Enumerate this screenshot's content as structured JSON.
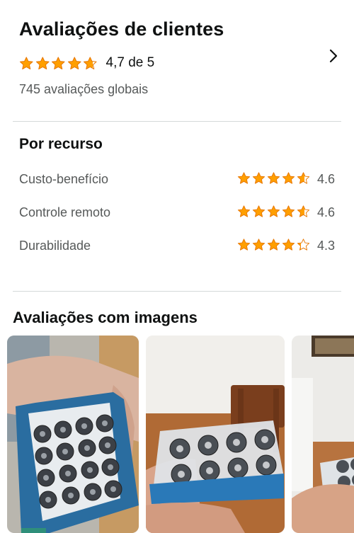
{
  "header": {
    "title": "Avaliações de clientes",
    "overall_rating": 4.7,
    "overall_text": "4,7 de 5",
    "global_count": "745 avaliações globais"
  },
  "features": {
    "title": "Por recurso",
    "items": [
      {
        "label": "Custo-benefício",
        "rating": 4.6,
        "value": "4.6"
      },
      {
        "label": "Controle remoto",
        "rating": 4.6,
        "value": "4.6"
      },
      {
        "label": "Durabilidade",
        "rating": 4.3,
        "value": "4.3"
      }
    ]
  },
  "images_section": {
    "title": "Avaliações com imagens",
    "images": [
      {
        "alt": "Caixa azul com pilhas AA"
      },
      {
        "alt": "Pacote plástico com pilhas AA"
      },
      {
        "alt": "Mão segurando pilhas"
      }
    ]
  },
  "colors": {
    "star": "#ff9f00",
    "star_outline": "#e77600",
    "divider": "#d5d9d9",
    "secondary_text": "#565959"
  },
  "icons": [
    "star-icon",
    "chevron-right-icon"
  ]
}
